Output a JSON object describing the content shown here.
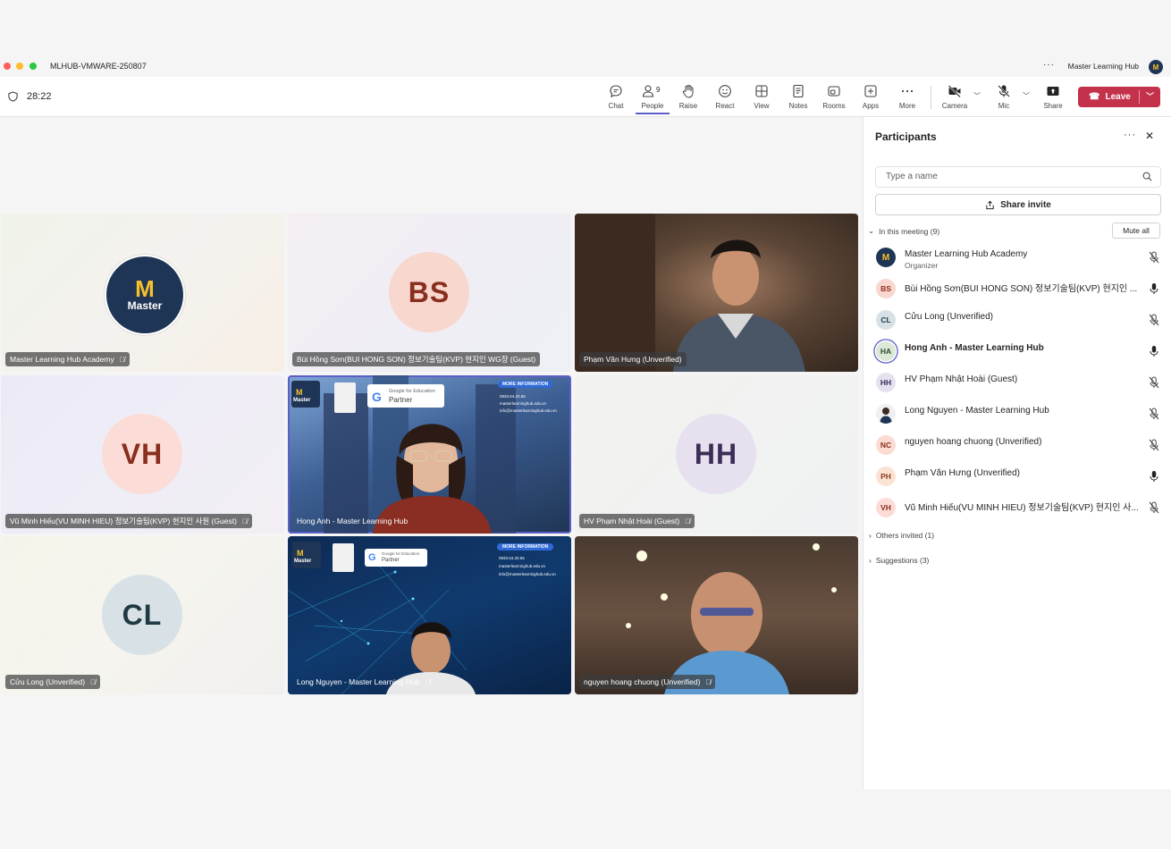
{
  "window": {
    "title": "MLHUB-VMWARE-250807",
    "account_name": "Master Learning Hub",
    "account_initial": "M"
  },
  "toolbar": {
    "timer": "28:22",
    "buttons": {
      "chat": "Chat",
      "people": "People",
      "people_count": "9",
      "raise": "Raise",
      "react": "React",
      "view": "View",
      "notes": "Notes",
      "rooms": "Rooms",
      "apps": "Apps",
      "more": "More",
      "camera": "Camera",
      "mic": "Mic",
      "share": "Share"
    },
    "leave": "Leave"
  },
  "tiles": [
    {
      "name": "Master Learning Hub Academy",
      "type": "logo"
    },
    {
      "name": "Bùi Hồng Sơn(BUI HONG SON) 정보기술팀(KVP) 현지인 WG장 (Guest)",
      "type": "avatar",
      "initials": "BS"
    },
    {
      "name": "Phạm Văn Hưng (Unverified)",
      "type": "video"
    },
    {
      "name": "Vũ Minh Hiếu(VU MINH HIEU) 정보기술팀(KVP) 현지인 사원 (Guest)",
      "type": "avatar",
      "initials": "VH"
    },
    {
      "name": "Hong Anh - Master Learning Hub",
      "type": "video"
    },
    {
      "name": "HV Phạm Nhật Hoài (Guest)",
      "type": "avatar",
      "initials": "HH"
    },
    {
      "name": "Cửu Long (Unverified)",
      "type": "avatar",
      "initials": "CL"
    },
    {
      "name": "Long Nguyen - Master Learning Hub",
      "type": "video"
    },
    {
      "name": "nguyen hoang chuong (Unverified)",
      "type": "video"
    }
  ],
  "slide": {
    "brand": "Master",
    "google_line1": "Google for Education",
    "google_line2": "Partner",
    "more_info": "MORE INFORMATION",
    "phone": "0933.54.20.55",
    "web": "masterlearninghub.edu.vn",
    "email": "info@masterlearninghub.edu.vn"
  },
  "panel": {
    "title": "Participants",
    "search_placeholder": "Type a name",
    "share_invite": "Share invite",
    "in_meeting": "In this meeting (9)",
    "mute_all": "Mute all",
    "others_invited": "Others invited (1)",
    "suggestions": "Suggestions (3)",
    "participants": [
      {
        "initials": "",
        "name": "Master Learning Hub Academy",
        "role": "Organizer",
        "mic": "muted"
      },
      {
        "initials": "BS",
        "name": "Bùi Hồng Sơn(BUI HONG SON) 정보기술팀(KVP) 현지인 ...",
        "role": "",
        "mic": "on"
      },
      {
        "initials": "CL",
        "name": "Cửu Long (Unverified)",
        "role": "",
        "mic": "muted"
      },
      {
        "initials": "HA",
        "name": "Hong Anh - Master Learning Hub",
        "role": "",
        "mic": "on"
      },
      {
        "initials": "HH",
        "name": "HV Phạm Nhật Hoài (Guest)",
        "role": "",
        "mic": "muted"
      },
      {
        "initials": "",
        "name": "Long Nguyen - Master Learning Hub",
        "role": "",
        "mic": "muted"
      },
      {
        "initials": "NC",
        "name": "nguyen hoang chuong (Unverified)",
        "role": "",
        "mic": "muted"
      },
      {
        "initials": "PH",
        "name": "Phạm Văn Hưng (Unverified)",
        "role": "",
        "mic": "on"
      },
      {
        "initials": "VH",
        "name": "Vũ Minh Hiếu(VU MINH HIEU) 정보기술팀(KVP) 현지인 사...",
        "role": "",
        "mic": "muted"
      }
    ]
  },
  "colors": {
    "accent": "#5b5fc7",
    "leave": "#c4314b",
    "brand_navy": "#1f3555",
    "brand_gold": "#f7c02a"
  }
}
